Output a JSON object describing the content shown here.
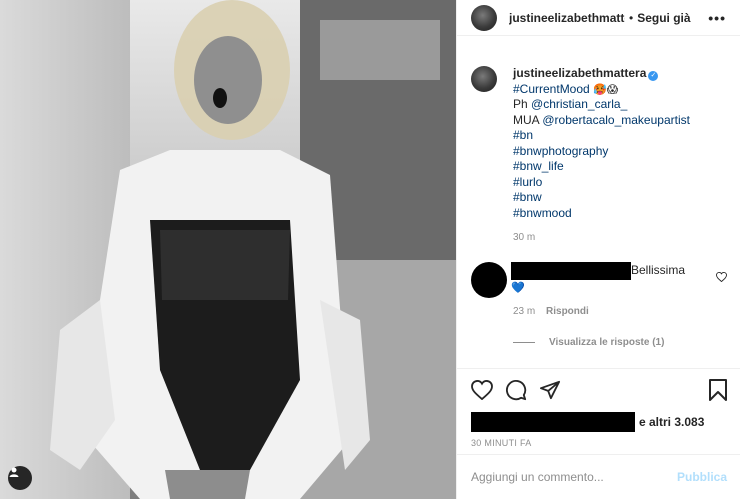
{
  "post": {
    "username": "justineelizabethmattera",
    "header_username_truncated": "justineelizabethmatte",
    "follow_status": "Segui già",
    "caption": {
      "line1": "#CurrentMood",
      "line1_emoji": "🥵😱",
      "ph_label": "Ph",
      "ph_handle": "@christian_carla_",
      "mua_label": "MUA",
      "mua_handle": "@robertacalo_makeupartist",
      "hashtags": [
        "#bn",
        "#bnwphotography",
        "#bnw_life",
        "#lurlo",
        "#bnw",
        "#bnwmood"
      ],
      "time": "30 m"
    },
    "comment": {
      "text": "Bellissima",
      "emoji": "💙",
      "time": "23 m",
      "reply_label": "Rispondi",
      "view_replies": "Visualizza le risposte (1)"
    },
    "likes_suffix": "e altri 3.083",
    "posted_ago": "30 MINUTI FA",
    "add_comment_placeholder": "Aggiungi un commento...",
    "publish_label": "Pubblica"
  }
}
